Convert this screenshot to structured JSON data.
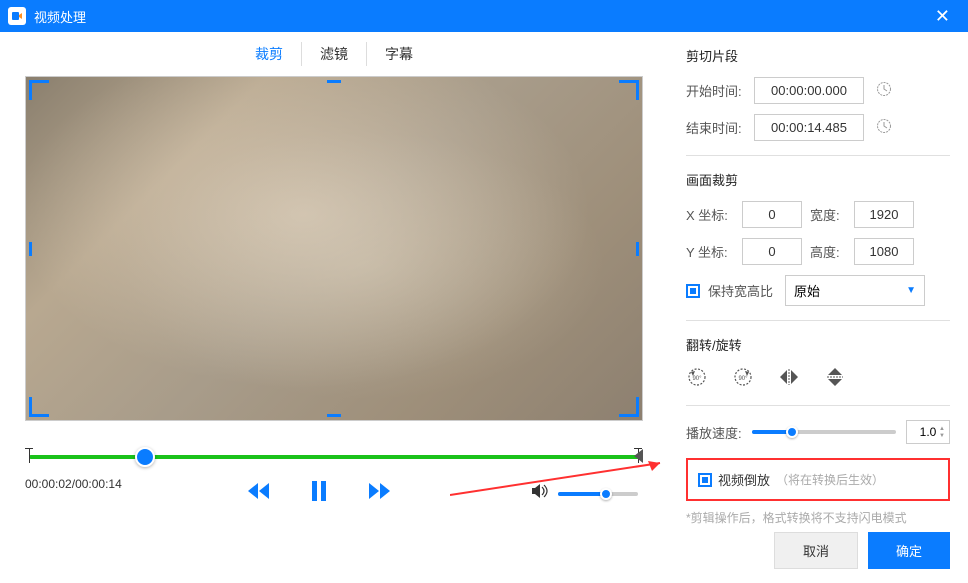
{
  "window": {
    "title": "视频处理"
  },
  "tabs": {
    "crop": "裁剪",
    "filter": "滤镜",
    "subtitle": "字幕"
  },
  "timeline": {
    "current": "00:00:02",
    "total": "00:00:14"
  },
  "clip": {
    "title": "剪切片段",
    "start_label": "开始时间:",
    "end_label": "结束时间:",
    "start_value": "00:00:00.000",
    "end_value": "00:00:14.485"
  },
  "crop": {
    "title": "画面裁剪",
    "x_label": "X 坐标:",
    "y_label": "Y 坐标:",
    "w_label": "宽度:",
    "h_label": "高度:",
    "x": "0",
    "y": "0",
    "w": "1920",
    "h": "1080",
    "ratio_label": "保持宽高比",
    "ratio_value": "原始"
  },
  "flip": {
    "title": "翻转/旋转"
  },
  "speed": {
    "label": "播放速度:",
    "value": "1.0"
  },
  "reverse": {
    "label": "视频倒放",
    "hint": "（将在转换后生效）"
  },
  "footer_hint": "*剪辑操作后，格式转换将不支持闪电模式",
  "buttons": {
    "cancel": "取消",
    "ok": "确定"
  }
}
